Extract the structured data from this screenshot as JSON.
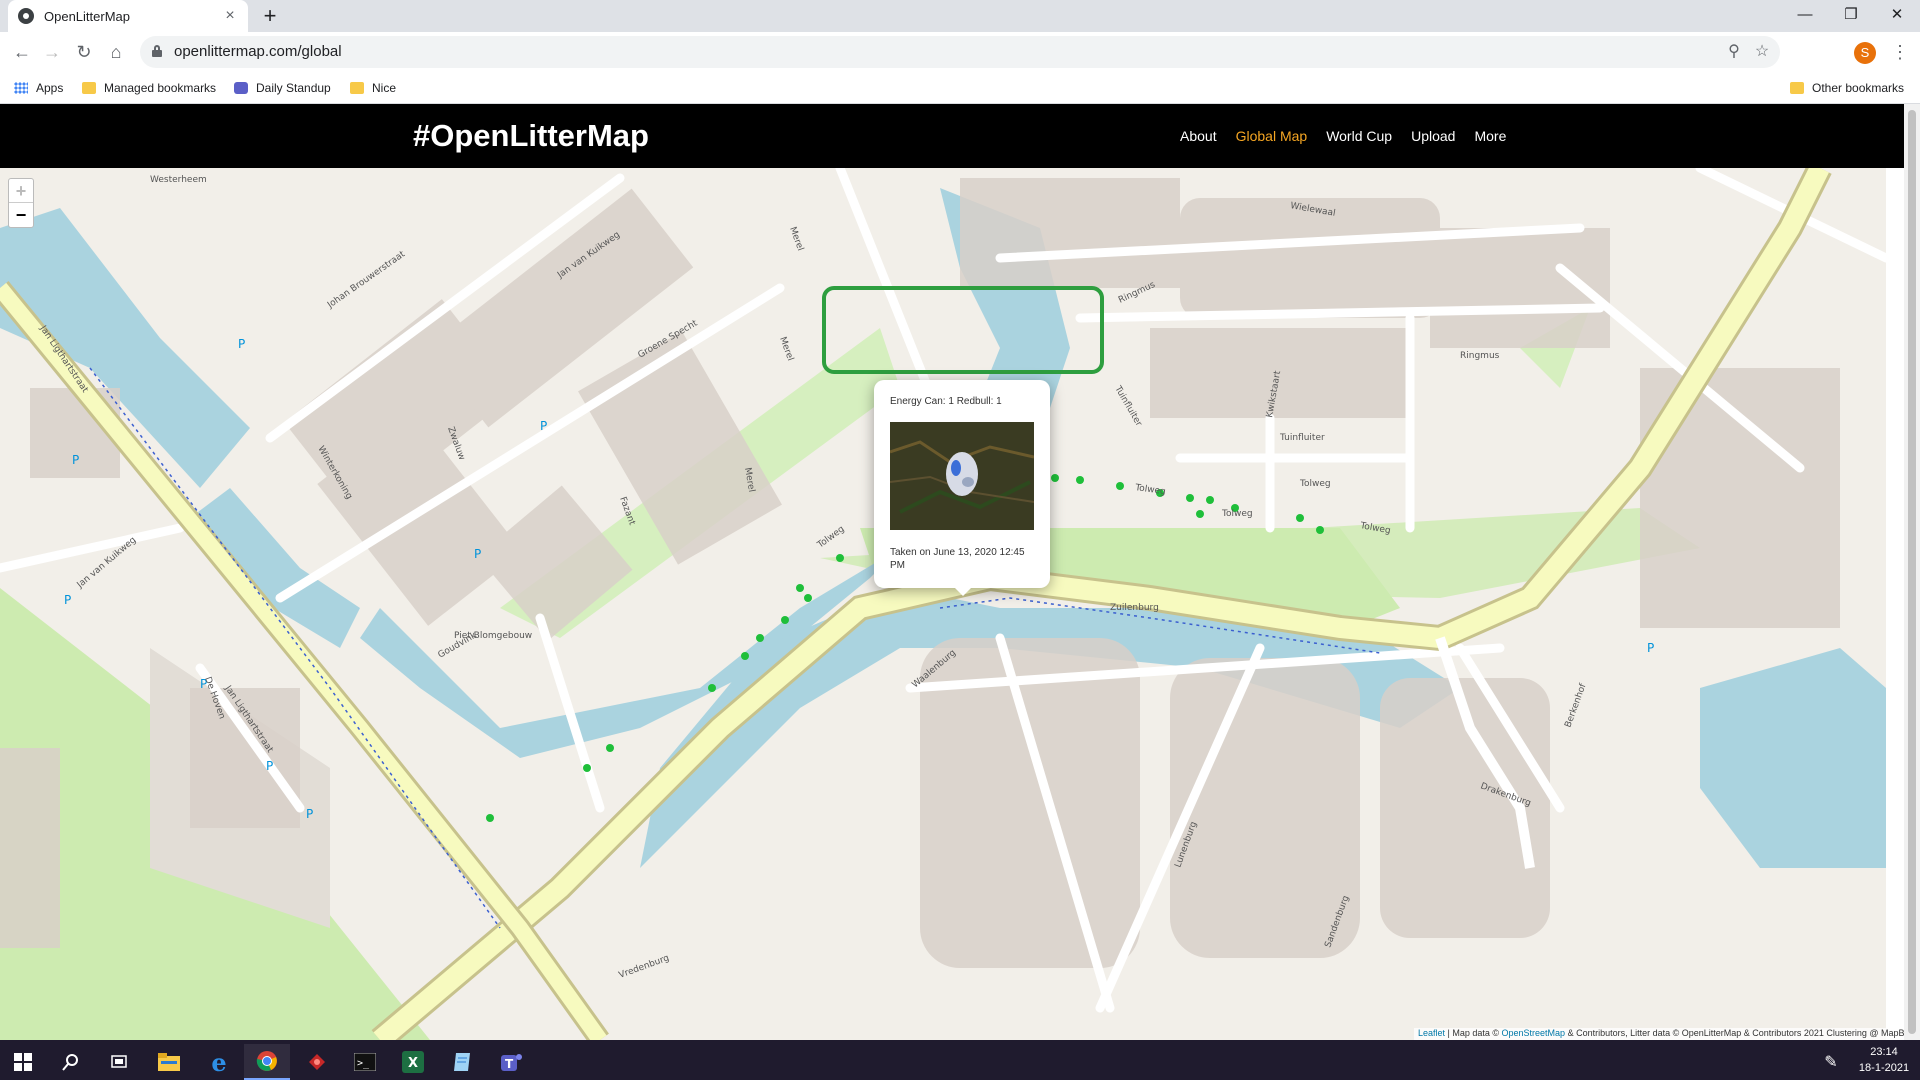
{
  "browser": {
    "tab_title": "OpenLitterMap",
    "url": "openlittermap.com/global",
    "profile_initial": "S",
    "bookmarks": [
      "Apps",
      "Managed bookmarks",
      "Daily Standup",
      "Nice"
    ],
    "other_bookmarks": "Other bookmarks"
  },
  "site": {
    "logo": "#OpenLitterMap",
    "nav": [
      "About",
      "Global Map",
      "World Cup",
      "Upload",
      "More"
    ],
    "active_nav": "Global Map",
    "accent_color": "#f5a623"
  },
  "map": {
    "zoom_in": "+",
    "zoom_out": "−",
    "popup": {
      "tags": "Energy Can: 1 Redbull: 1",
      "caption": "Taken on June 13, 2020 12:45 PM"
    },
    "street_labels": [
      "Tolweg",
      "Tolweg",
      "Tolweg",
      "Tolweg",
      "Tolweg",
      "Ringmus",
      "Ringmus",
      "Wielewaal",
      "Tuinfluiter",
      "Tuinfluiter",
      "Zuilenburg",
      "Lunenburg",
      "Drakenburg",
      "Sandenburg",
      "Berkenhof",
      "Jan Ligthartstraat",
      "Jan Ligthartstraat",
      "Jan van Kuikweg",
      "Jan van Kuikweg",
      "Johan Brouwerstraat",
      "Groene Specht",
      "Merel",
      "Merel",
      "Merel",
      "Fazant",
      "Goudvink",
      "Zwaluw",
      "Winterkoning",
      "De Hoven",
      "Vredenburg",
      "Waalenburg",
      "Piet Blomgebouw",
      "Westerheem",
      "Kwikstaart"
    ],
    "attribution_prefix": "Leaflet",
    "attribution_text": " | Map data © ",
    "attribution_osm": "OpenStreetMap",
    "attribution_rest": " & Contributors, Litter data © OpenLitterMap & Contributors 2021 Clustering @ MapBox",
    "colors": {
      "water": "#aad3df",
      "park": "#cdebb0",
      "road": "#f7fabf",
      "building": "#d9d0c9",
      "litter_point": "#1fbf3a",
      "highlight_box": "#2e9e3f",
      "cursor_circle": "#cc1a1a"
    }
  },
  "taskbar": {
    "time": "23:14",
    "date": "18-1-2021",
    "apps": [
      "start-icon",
      "search-icon",
      "task-view-icon",
      "file-explorer-icon",
      "edge-icon",
      "chrome-icon",
      "app-red-icon",
      "terminal-icon",
      "excel-icon",
      "notepad-icon",
      "teams-icon"
    ]
  }
}
